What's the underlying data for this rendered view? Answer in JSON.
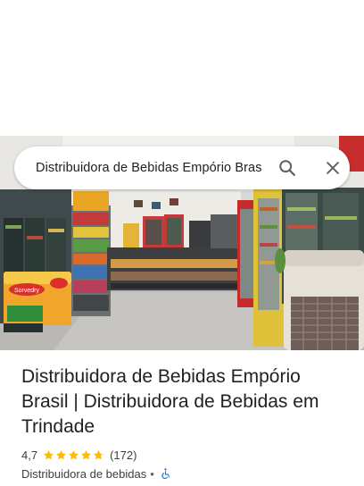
{
  "search": {
    "query": "Distribuidora de Bebidas Empório Brasil"
  },
  "photo": {
    "left_sign_main": "Sorvedry"
  },
  "place": {
    "title": "Distribuidora de Bebidas Empório Brasil | Distribuidora de Bebidas em Trindade",
    "rating": "4,7",
    "rating_value": 4.7,
    "review_count": "(172)",
    "category": "Distribuidora de bebidas",
    "separator": "•"
  },
  "colors": {
    "star": "#fbbc04",
    "accessibility": "#1a73e8",
    "icon": "#5f6368"
  },
  "icons": [
    "search-icon",
    "close-icon",
    "star-icon",
    "accessibility-icon"
  ]
}
